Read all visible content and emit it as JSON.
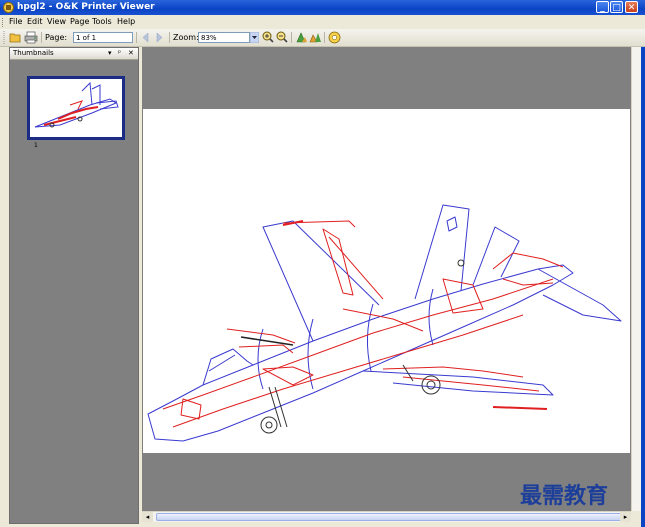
{
  "window": {
    "title": "hpgl2 - O&K Printer Viewer",
    "minimize": "_",
    "maximize": "□",
    "close": "✕"
  },
  "menu": [
    "File",
    "Edit",
    "View",
    "Page",
    "Tools",
    "Help"
  ],
  "toolbar": {
    "page_label": "Page:",
    "page_value": "1 of 1",
    "zoom_label": "Zoom:",
    "zoom_value": "83%",
    "icons": [
      "open-icon",
      "print-icon",
      "prev-page-icon",
      "next-page-icon",
      "zoom-dropdown-icon",
      "zoom-in-icon",
      "zoom-out-icon",
      "rotate-left-icon",
      "rotate-right-icon",
      "help-icon"
    ]
  },
  "thumbnails": {
    "title": "Thumbnails",
    "controls": [
      "▾",
      "ᵖ",
      "✕"
    ],
    "items": [
      {
        "label": "1"
      }
    ]
  },
  "watermark": "最需教育",
  "colors": {
    "titlebar": "#0a44c4",
    "viewer_bg": "#808080",
    "drawing_blue": "#3a3ad0",
    "drawing_red": "#e02020"
  }
}
